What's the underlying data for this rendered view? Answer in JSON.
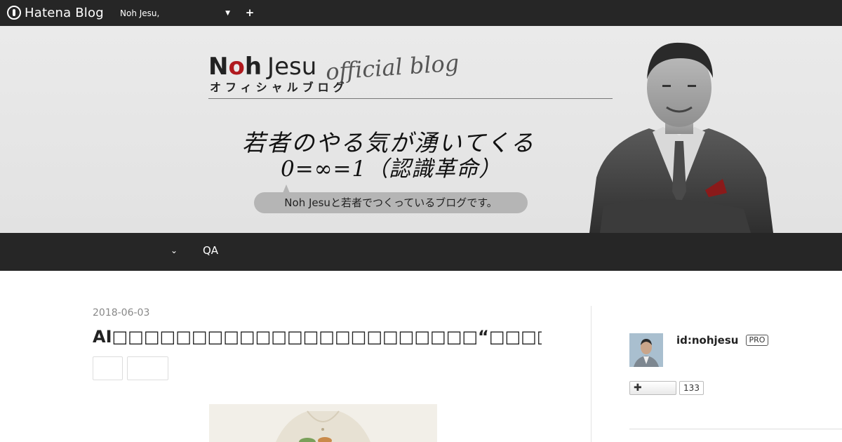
{
  "globalbar": {
    "logo_text": "Hatena Blog",
    "blog_selector": "Noh Jesu,",
    "plus_label": "+"
  },
  "header": {
    "title_noh_n": "N",
    "title_noh_o": "o",
    "title_noh_h": "h",
    "title_jesu": "Jesu",
    "title_script": "official blog",
    "title_sub": "オフィシャルブログ",
    "slogan_line1": "若者のやる気が湧いてくる",
    "slogan_line2": "0=∞=1（認識革命）",
    "bubble_text": "Noh Jesuと若者でつくっているブログです。"
  },
  "nav": {
    "caret": "⌄",
    "qa_label": "QA"
  },
  "entry": {
    "date": "2018-06-03",
    "title": "AI□□□□□□□□□□□□□□□□□□□□□□□“□□□□□□□□□□□□□□□”"
  },
  "sidebar": {
    "profile_id": "id:nohjesu",
    "pro_badge": "PRO",
    "follow_label": "✚",
    "follow_count": "133"
  },
  "colors": {
    "bar": "#262626",
    "accent_red": "#b0191e",
    "banner_bg": "#e6e6e6"
  },
  "icons": {
    "logo": "hatena-logo-icon",
    "caret": "chevron-down-icon",
    "plus": "plus-icon"
  }
}
